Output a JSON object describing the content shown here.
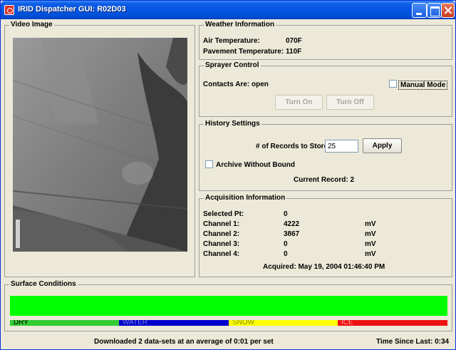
{
  "window": {
    "title": "IRID Dispatcher GUI: R02D03"
  },
  "video": {
    "title": "Video Image"
  },
  "weather": {
    "title": "Weather Information",
    "air_label": "Air Temperature:",
    "air_value": "070F",
    "pavement_label": "Pavement Temperature:",
    "pavement_value": "110F"
  },
  "sprayer": {
    "title": "Sprayer Control",
    "contacts": "Contacts Are: open",
    "manual_mode_label": "Manual Mode",
    "manual_mode_checked": false,
    "turn_on_label": "Turn On",
    "turn_off_label": "Turn Off"
  },
  "history": {
    "title": "History Settings",
    "records_label": "# of Records to Store:",
    "records_value": "25",
    "apply_label": "Apply",
    "archive_label": "Archive Without Bound",
    "archive_checked": false,
    "current_record": "Current Record: 2"
  },
  "acquisition": {
    "title": "Acquisition Information",
    "selected_label": "Selected Pt:",
    "selected_value": "0",
    "channels": [
      {
        "label": "Channel 1:",
        "value": "4222",
        "unit": "mV"
      },
      {
        "label": "Channel 2:",
        "value": "3867",
        "unit": "mV"
      },
      {
        "label": "Channel 3:",
        "value": "0",
        "unit": "mV"
      },
      {
        "label": "Channel 4:",
        "value": "0",
        "unit": "mV"
      }
    ],
    "acquired": "Acquired: May 19, 2004 01:46:40 PM"
  },
  "surface": {
    "title": "Surface Conditions",
    "current_color": "#00ff00",
    "legend": [
      {
        "label": "DRY",
        "color": "#33cc33"
      },
      {
        "label": "WATER",
        "color": "#0000cc"
      },
      {
        "label": "SNOW",
        "color": "#ffff00"
      },
      {
        "label": "ICE",
        "color": "#ee1111"
      }
    ]
  },
  "status": {
    "downloaded": "Downloaded  2  data-sets at an average of  0:01  per set",
    "time_since": "Time Since Last: 0:34"
  }
}
